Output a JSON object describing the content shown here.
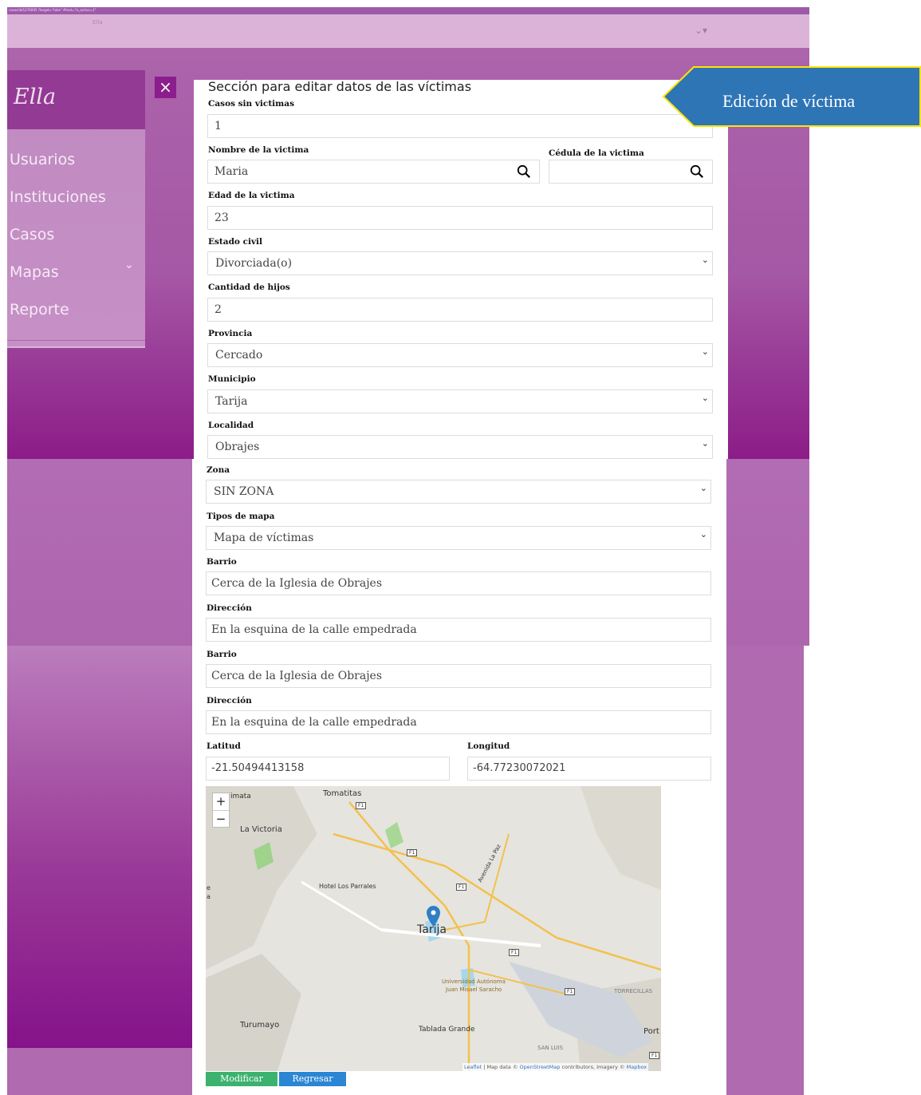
{
  "topbar": {
    "url_fragment": "casos/id/1276005 ?target=\"tabs\" #text=\"is_active=1\"",
    "brand": "Ella",
    "menu_glyph": "⌄▾"
  },
  "sidebar": {
    "logo": "Ella",
    "items": [
      {
        "label": "Usuarios"
      },
      {
        "label": "Instituciones"
      },
      {
        "label": "Casos"
      },
      {
        "label": "Mapas"
      },
      {
        "label": "Reporte"
      }
    ],
    "mapas_chevron": "⌄",
    "close_glyph": "×"
  },
  "callout": {
    "text": "Edición de víctima",
    "color": "#2e75b6",
    "border": "#ffe400"
  },
  "form": {
    "title": "Sección para editar datos de las víctimas",
    "casos_sin_victimas": {
      "label": "Casos sin victimas",
      "value": "1"
    },
    "nombre": {
      "label": "Nombre de la victima",
      "value": "Maria"
    },
    "cedula": {
      "label": "Cédula de la victima",
      "value": ""
    },
    "edad": {
      "label": "Edad de la victima",
      "value": "23"
    },
    "estado_civil": {
      "label": "Estado civil",
      "value": "Divorciada(o)"
    },
    "hijos": {
      "label": "Cantidad de hijos",
      "value": "2"
    },
    "provincia": {
      "label": "Provincia",
      "value": "Cercado"
    },
    "municipio": {
      "label": "Municipio",
      "value": "Tarija"
    },
    "localidad": {
      "label": "Localidad",
      "value": "Obrajes"
    },
    "zona": {
      "label": "Zona",
      "value": "SIN ZONA"
    },
    "tipo_mapa": {
      "label": "Tipos de mapa",
      "value": "Mapa de víctimas"
    },
    "barrio_1": {
      "label": "Barrio",
      "value": "Cerca de la Iglesia de Obrajes"
    },
    "direccion_1": {
      "label": "Dirección",
      "value": "En la esquina de la calle empedrada"
    },
    "barrio_2": {
      "label": "Barrio",
      "value": "Cerca de la Iglesia de Obrajes"
    },
    "direccion_2": {
      "label": "Dirección",
      "value": "En la esquina de la calle empedrada"
    },
    "latitud": {
      "label": "Latitud",
      "value": "-21.50494413158"
    },
    "longitud": {
      "label": "Longitud",
      "value": "-64.77230072021"
    }
  },
  "map": {
    "zoom_in": "+",
    "zoom_out": "−",
    "labels": {
      "imata": "imata",
      "tomatitas": "Tomatitas",
      "la_victoria": "La Victoria",
      "hotel": "Hotel Los Parrales",
      "avenida": "Avenida La Paz",
      "tarija": "Tarija",
      "universidad_1": "Universidad Autónoma",
      "universidad_2": "Juan Misael Saracho",
      "torrecillas": "TORRECILLAS",
      "turumayo": "Turumayo",
      "tablada": "Tablada Grande",
      "san_luis": "SAN LUIS",
      "port": "Port",
      "edge_e": "e",
      "edge_a": "a",
      "f1": "F1"
    },
    "attribution": {
      "leaflet": "Leaflet",
      "sep": " | Map data © ",
      "osm": "OpenStreetMap",
      "mid": " contributors, Imagery © ",
      "mapbox": "Mapbox"
    }
  },
  "buttons": {
    "modificar": "Modificar",
    "regresar": "Regresar"
  },
  "colors": {
    "purple": "#a558a5",
    "dark_purple": "#8a1e8c",
    "modificar": "#3cb26f",
    "regresar": "#2b86d4"
  }
}
